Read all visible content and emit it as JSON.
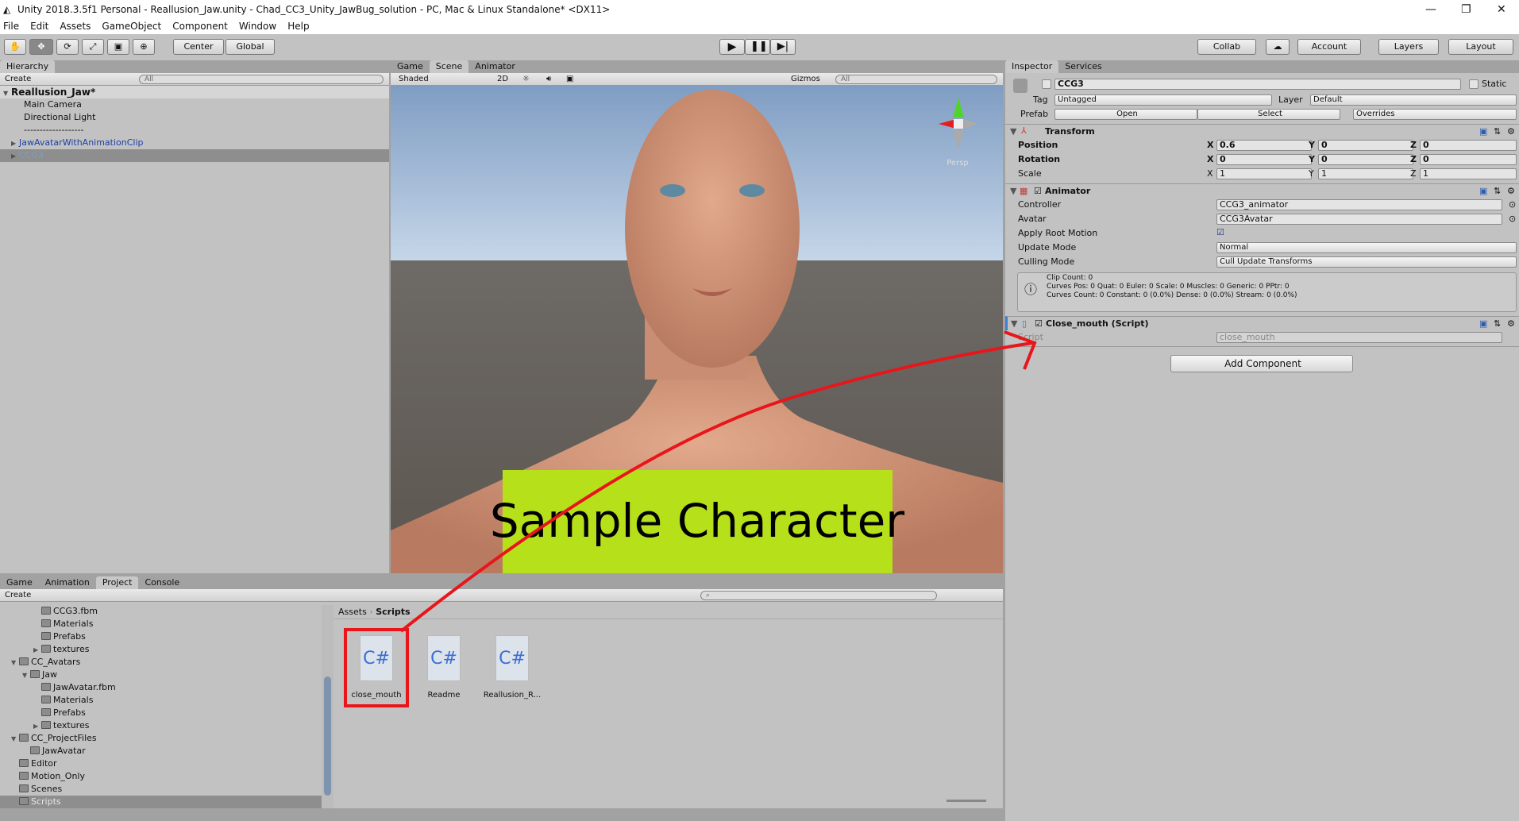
{
  "window": {
    "title": "Unity 2018.3.5f1 Personal - Reallusion_Jaw.unity - Chad_CC3_Unity_JawBug_solution - PC, Mac & Linux Standalone* <DX11>",
    "controls": [
      "—",
      "❐",
      "✕"
    ]
  },
  "menu": [
    "File",
    "Edit",
    "Assets",
    "GameObject",
    "Component",
    "Window",
    "Help"
  ],
  "toolbar": {
    "tools": [
      "hand-tool",
      "move-tool",
      "rotate-tool",
      "scale-tool",
      "rect-tool",
      "transform-tool"
    ],
    "pivot": "Center",
    "space": "Global",
    "collab": "Collab",
    "account": "Account",
    "layers": "Layers",
    "layout": "Layout"
  },
  "hierarchy": {
    "tab": "Hierarchy",
    "create": "Create",
    "search_placeholder": "All",
    "scene": "Reallusion_Jaw*",
    "items": [
      {
        "label": "Main Camera"
      },
      {
        "label": "Directional Light"
      },
      {
        "label": "-------------------"
      },
      {
        "label": "JawAvatarWithAnimationClip"
      },
      {
        "label": "CCG3"
      }
    ]
  },
  "sceneview": {
    "tabs": [
      "Game",
      "Scene",
      "Animator"
    ],
    "active_tab": "Scene",
    "shading": "Shaded",
    "mode2d": "2D",
    "gizmos": "Gizmos",
    "search_placeholder": "All",
    "projection": "Persp",
    "banner": "Sample Character",
    "banner_color": "#b6e01a"
  },
  "inspector": {
    "tabs": [
      "Inspector",
      "Services"
    ],
    "object_name": "CCG3",
    "static": "Static",
    "tag_label": "Tag",
    "tag": "Untagged",
    "layer_label": "Layer",
    "layer": "Default",
    "prefab_label": "Prefab",
    "prefab_open": "Open",
    "prefab_select": "Select",
    "prefab_overrides": "Overrides",
    "transform": {
      "title": "Transform",
      "position_label": "Position",
      "rotation_label": "Rotation",
      "scale_label": "Scale",
      "position": [
        "0.6",
        "0",
        "0"
      ],
      "rotation": [
        "0",
        "0",
        "0"
      ],
      "scale": [
        "1",
        "1",
        "1"
      ],
      "axes": [
        "X",
        "Y",
        "Z"
      ]
    },
    "animator": {
      "title": "Animator",
      "controller_label": "Controller",
      "controller": "CCG3_animator",
      "avatar_label": "Avatar",
      "avatar": "CCG3Avatar",
      "root_motion_label": "Apply Root Motion",
      "root_motion": true,
      "update_mode_label": "Update Mode",
      "update_mode": "Normal",
      "culling_mode_label": "Culling Mode",
      "culling_mode": "Cull Update Transforms",
      "info": [
        "Clip Count: 0",
        "Curves Pos: 0 Quat: 0 Euler: 0 Scale: 0 Muscles: 0 Generic: 0 PPtr: 0",
        "Curves Count: 0 Constant: 0 (0.0%) Dense: 0 (0.0%) Stream: 0 (0.0%)"
      ]
    },
    "script": {
      "title": "Close_mouth (Script)",
      "script_label": "Script",
      "script": "close_mouth"
    },
    "add_component": "Add Component"
  },
  "bottom": {
    "tabs": [
      "Game",
      "Animation",
      "Project",
      "Console"
    ],
    "active_tab": "Project",
    "create": "Create",
    "tree": [
      {
        "label": "CCG3.fbm",
        "depth": 3
      },
      {
        "label": "Materials",
        "depth": 3
      },
      {
        "label": "Prefabs",
        "depth": 3
      },
      {
        "label": "textures",
        "depth": 3,
        "arrow": "▶"
      },
      {
        "label": "CC_Avatars",
        "depth": 1,
        "arrow": "▼"
      },
      {
        "label": "Jaw",
        "depth": 2,
        "arrow": "▼"
      },
      {
        "label": "JawAvatar.fbm",
        "depth": 3
      },
      {
        "label": "Materials",
        "depth": 3
      },
      {
        "label": "Prefabs",
        "depth": 3
      },
      {
        "label": "textures",
        "depth": 3,
        "arrow": "▶"
      },
      {
        "label": "CC_ProjectFiles",
        "depth": 1,
        "arrow": "▼"
      },
      {
        "label": "JawAvatar",
        "depth": 2
      },
      {
        "label": "Editor",
        "depth": 1
      },
      {
        "label": "Motion_Only",
        "depth": 1
      },
      {
        "label": "Scenes",
        "depth": 1
      },
      {
        "label": "Scripts",
        "depth": 1,
        "selected": true
      }
    ],
    "breadcrumb": [
      "Assets",
      "Scripts"
    ],
    "files": [
      {
        "label": "close_mouth",
        "icon": "C#"
      },
      {
        "label": "Readme",
        "icon": "C#"
      },
      {
        "label": "Reallusion_R...",
        "icon": "C#"
      }
    ]
  },
  "annotation_color": "#e8161b"
}
